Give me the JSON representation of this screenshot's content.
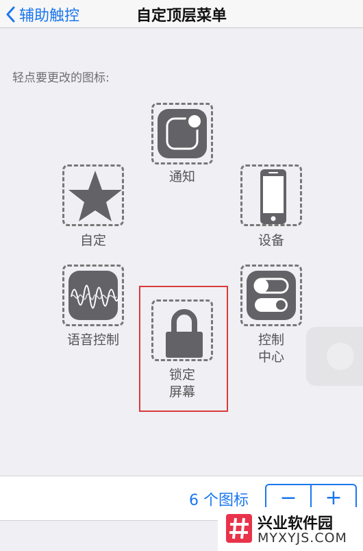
{
  "nav": {
    "back_label": "辅助触控",
    "title": "自定顶层菜单"
  },
  "section_label": "轻点要更改的图标:",
  "icons": [
    {
      "label": "通知",
      "icon": "notification-icon"
    },
    {
      "label": "自定",
      "icon": "star-icon"
    },
    {
      "label": "设备",
      "icon": "device-icon"
    },
    {
      "label": "语音控制",
      "icon": "voice-control-icon"
    },
    {
      "label": "控制\n中心",
      "label_lines": [
        "控制",
        "中心"
      ],
      "icon": "control-center-icon"
    },
    {
      "label": "锁定\n屏幕",
      "label_lines": [
        "锁定",
        "屏幕"
      ],
      "icon": "lock-icon"
    }
  ],
  "bottom": {
    "count_label": "6 个图标",
    "minus": "−",
    "plus": "+"
  },
  "watermark": {
    "title": "兴业软件园",
    "url": "MYXYJS.COM"
  },
  "colors": {
    "accent": "#1a76f0",
    "highlight": "#d83a3a",
    "tile": "#636367"
  }
}
